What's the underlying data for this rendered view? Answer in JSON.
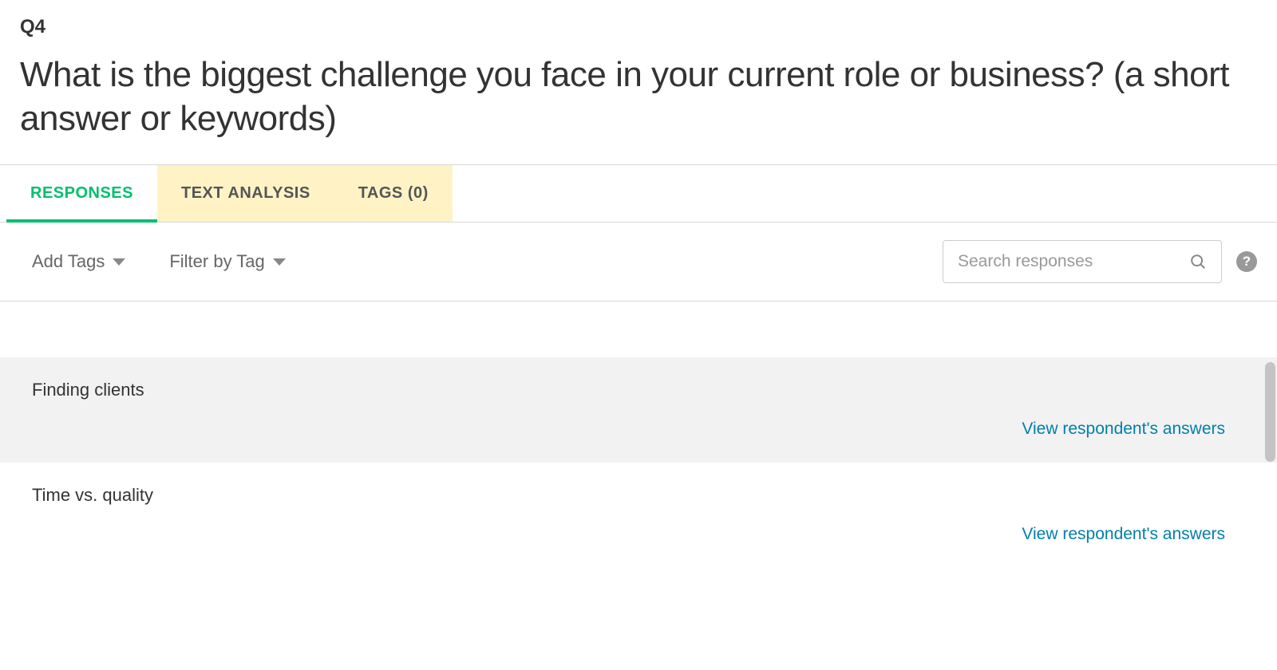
{
  "question": {
    "number": "Q4",
    "text": "What is the biggest challenge you face in your current role or business? (a short answer or keywords)"
  },
  "tabs": [
    {
      "label": "RESPONSES",
      "state": "active"
    },
    {
      "label": "TEXT ANALYSIS",
      "state": "highlighted"
    },
    {
      "label": "TAGS (0)",
      "state": "highlighted"
    }
  ],
  "toolbar": {
    "add_tags": "Add Tags",
    "filter_by_tag": "Filter by Tag"
  },
  "search": {
    "placeholder": "Search responses"
  },
  "responses": [
    {
      "text": "Finding clients",
      "link": "View respondent's answers"
    },
    {
      "text": "Time vs. quality",
      "link": "View respondent's answers"
    }
  ]
}
